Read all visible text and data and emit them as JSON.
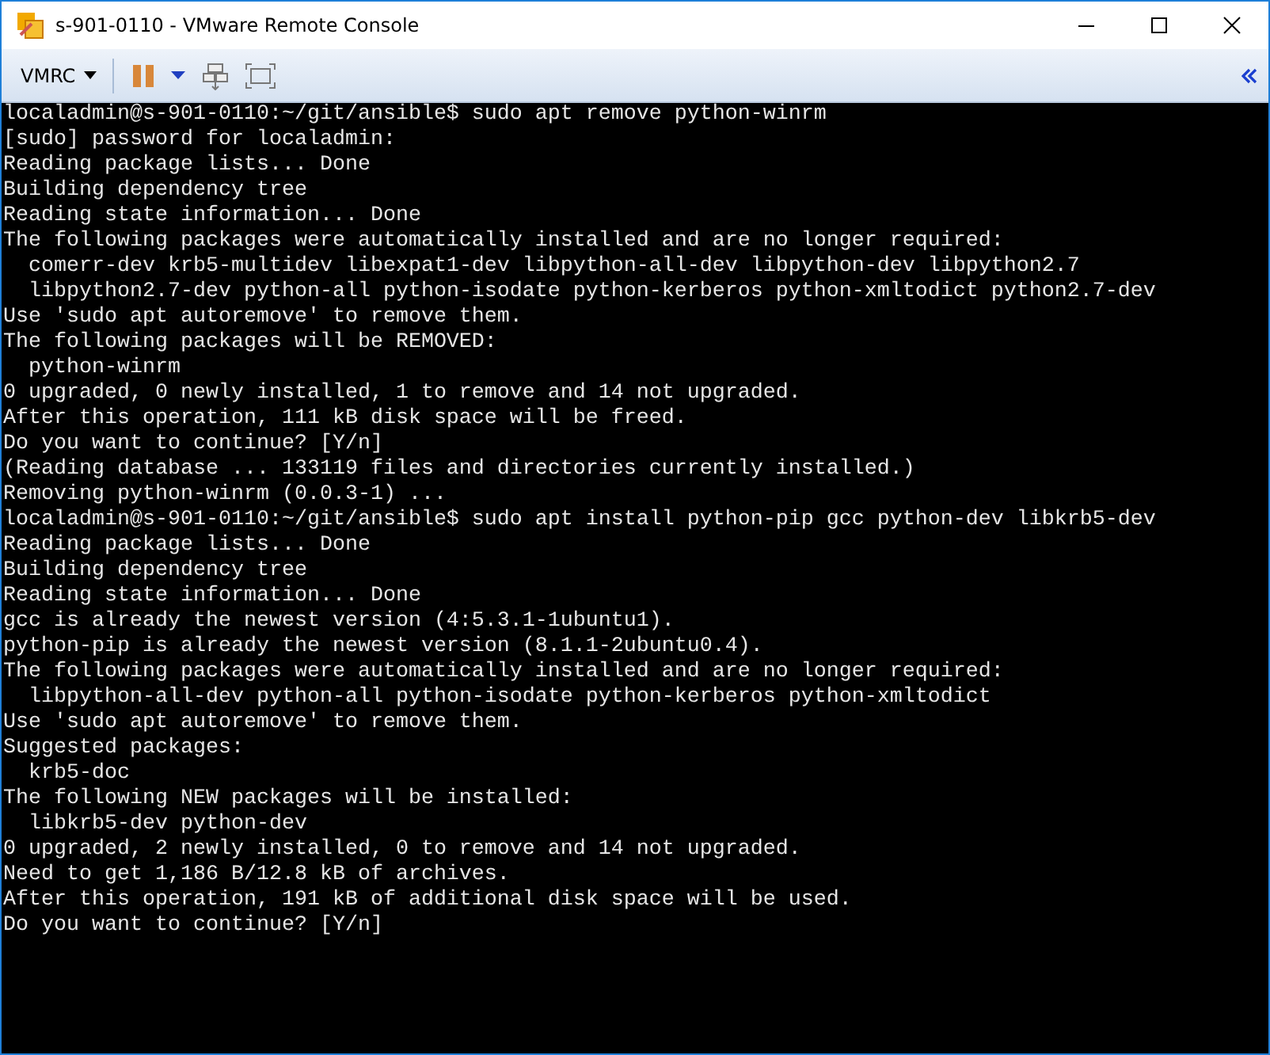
{
  "window": {
    "title": "s-901-0110 - VMware Remote Console"
  },
  "toolbar": {
    "menu": "VMRC"
  },
  "terminal": {
    "lines": [
      {
        "text": "localadmin@s-901-0110:~/git/ansible$ sudo apt remove python-winrm",
        "indented": false
      },
      {
        "text": "[sudo] password for localadmin:",
        "indented": false
      },
      {
        "text": "Reading package lists... Done",
        "indented": false
      },
      {
        "text": "Building dependency tree",
        "indented": false
      },
      {
        "text": "Reading state information... Done",
        "indented": false
      },
      {
        "text": "The following packages were automatically installed and are no longer required:",
        "indented": false
      },
      {
        "text": "comerr-dev krb5-multidev libexpat1-dev libpython-all-dev libpython-dev libpython2.7",
        "indented": true
      },
      {
        "text": "libpython2.7-dev python-all python-isodate python-kerberos python-xmltodict python2.7-dev",
        "indented": true
      },
      {
        "text": "Use 'sudo apt autoremove' to remove them.",
        "indented": false
      },
      {
        "text": "The following packages will be REMOVED:",
        "indented": false
      },
      {
        "text": "python-winrm",
        "indented": true
      },
      {
        "text": "0 upgraded, 0 newly installed, 1 to remove and 14 not upgraded.",
        "indented": false
      },
      {
        "text": "After this operation, 111 kB disk space will be freed.",
        "indented": false
      },
      {
        "text": "Do you want to continue? [Y/n]",
        "indented": false
      },
      {
        "text": "(Reading database ... 133119 files and directories currently installed.)",
        "indented": false
      },
      {
        "text": "Removing python-winrm (0.0.3-1) ...",
        "indented": false
      },
      {
        "text": "localadmin@s-901-0110:~/git/ansible$ sudo apt install python-pip gcc python-dev libkrb5-dev",
        "indented": false
      },
      {
        "text": "Reading package lists... Done",
        "indented": false
      },
      {
        "text": "Building dependency tree",
        "indented": false
      },
      {
        "text": "Reading state information... Done",
        "indented": false
      },
      {
        "text": "gcc is already the newest version (4:5.3.1-1ubuntu1).",
        "indented": false
      },
      {
        "text": "python-pip is already the newest version (8.1.1-2ubuntu0.4).",
        "indented": false
      },
      {
        "text": "The following packages were automatically installed and are no longer required:",
        "indented": false
      },
      {
        "text": "libpython-all-dev python-all python-isodate python-kerberos python-xmltodict",
        "indented": true
      },
      {
        "text": "Use 'sudo apt autoremove' to remove them.",
        "indented": false
      },
      {
        "text": "Suggested packages:",
        "indented": false
      },
      {
        "text": "krb5-doc",
        "indented": true
      },
      {
        "text": "The following NEW packages will be installed:",
        "indented": false
      },
      {
        "text": "libkrb5-dev python-dev",
        "indented": true
      },
      {
        "text": "0 upgraded, 2 newly installed, 0 to remove and 14 not upgraded.",
        "indented": false
      },
      {
        "text": "Need to get 1,186 B/12.8 kB of archives.",
        "indented": false
      },
      {
        "text": "After this operation, 191 kB of additional disk space will be used.",
        "indented": false
      },
      {
        "text": "Do you want to continue? [Y/n]",
        "indented": false
      }
    ]
  }
}
